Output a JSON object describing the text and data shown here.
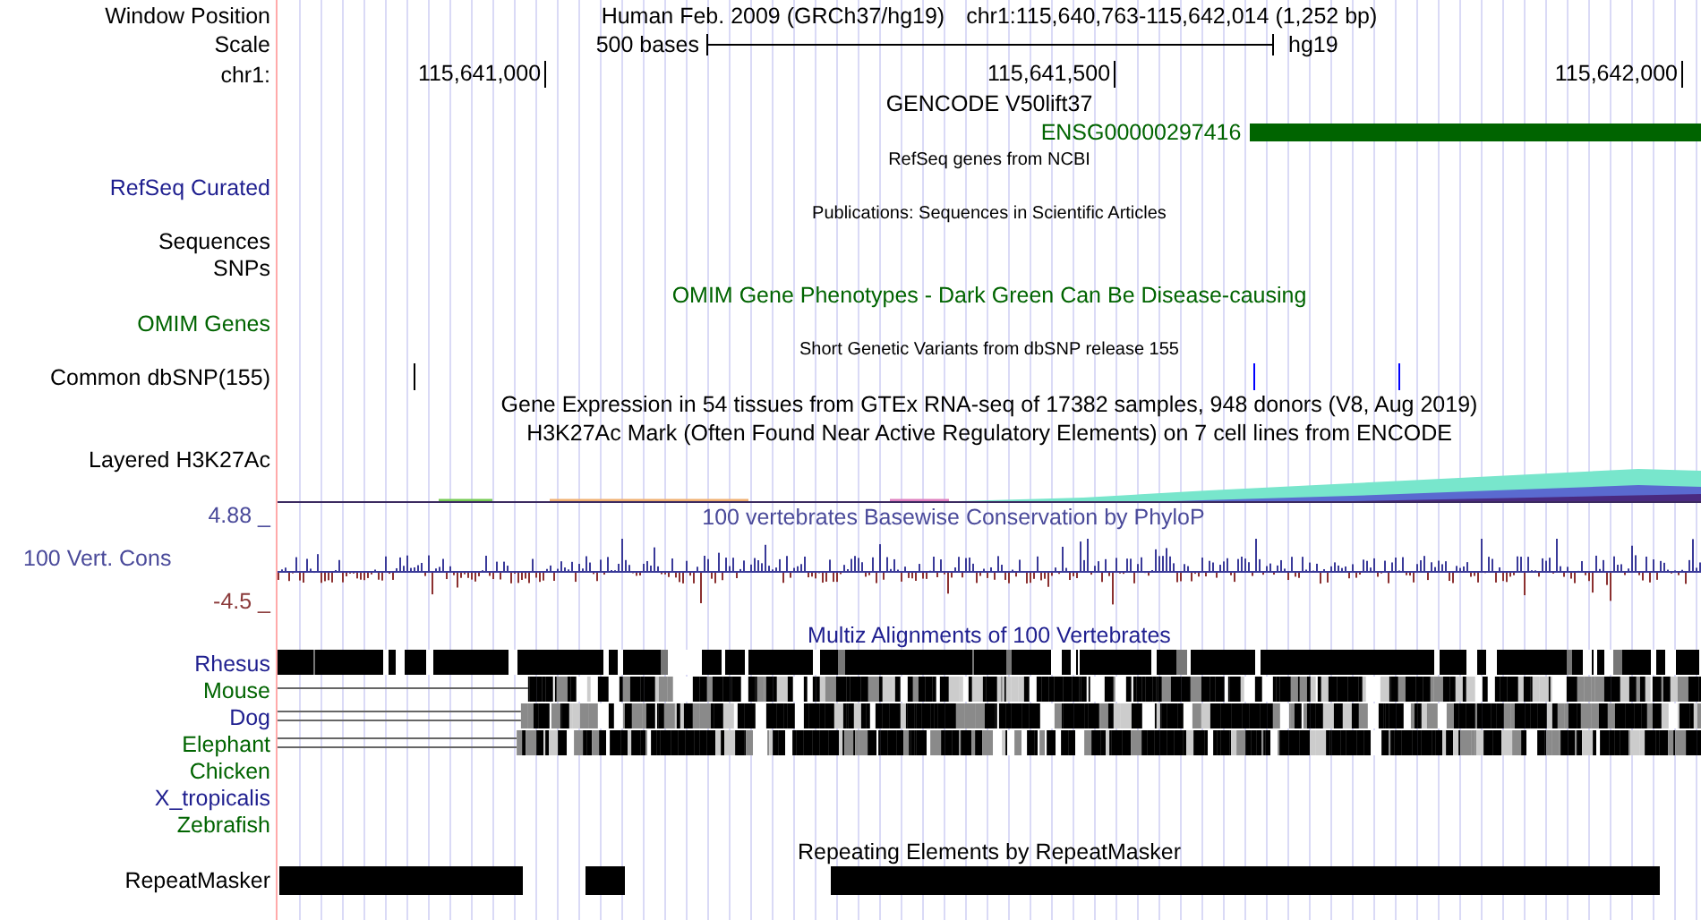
{
  "header": {
    "label": "Window Position",
    "assembly": "Human Feb. 2009 (GRCh37/hg19)",
    "position": "chr1:115,640,763-115,642,014 (1,252 bp)"
  },
  "scale": {
    "label": "Scale",
    "length": "500 bases",
    "assembly": "hg19"
  },
  "ruler": {
    "label": "chr1:",
    "ticks": [
      "115,641,000",
      "115,641,500",
      "115,642,000"
    ]
  },
  "tracks": [
    {
      "kind": "title",
      "text": "GENCODE V50lift37",
      "color": "#000000"
    },
    {
      "kind": "gene",
      "name": "ENSG00000297416",
      "color": "#006400"
    },
    {
      "kind": "note",
      "text": "RefSeq genes from NCBI"
    },
    {
      "kind": "label",
      "label": "RefSeq Curated",
      "color": "#1f1f8f"
    },
    {
      "kind": "note",
      "text": "Publications: Sequences in Scientific Articles"
    },
    {
      "kind": "label",
      "label": "Sequences",
      "color": "#000000"
    },
    {
      "kind": "label",
      "label": "SNPs",
      "color": "#000000"
    },
    {
      "kind": "title",
      "text": "OMIM Gene Phenotypes - Dark Green Can Be Disease-causing",
      "color": "#006400"
    },
    {
      "kind": "label",
      "label": "OMIM Genes",
      "color": "#006400"
    },
    {
      "kind": "note",
      "text": "Short Genetic Variants from dbSNP release 155"
    },
    {
      "kind": "variants",
      "label": "Common dbSNP(155)",
      "color": "#000000",
      "variants": [
        {
          "color": "#000000"
        },
        {
          "color": "#0000ff"
        },
        {
          "color": "#0000ff"
        }
      ]
    },
    {
      "kind": "title",
      "text": "Gene Expression in 54 tissues from GTEx RNA-seq of 17382 samples, 948 donors (V8, Aug 2019)",
      "color": "#000000"
    },
    {
      "kind": "title",
      "text": "H3K27Ac Mark (Often Found Near Active Regulatory Elements) on 7 cell lines from ENCODE",
      "color": "#000000"
    },
    {
      "kind": "layered",
      "label": "Layered H3K27Ac",
      "color": "#000000"
    },
    {
      "kind": "wiggle",
      "label": "100 Vert. Cons",
      "color": "#4a4a9a",
      "title": "100 vertebrates Basewise Conservation by PhyloP",
      "max": "4.88 _",
      "min": "-4.5 _"
    },
    {
      "kind": "title",
      "text": "Multiz Alignments of 100 Vertebrates",
      "color": "#1f1f8f"
    },
    {
      "kind": "alignment",
      "label": "Rhesus",
      "color": "#1f1f8f"
    },
    {
      "kind": "alignment",
      "label": "Mouse",
      "color": "#006400"
    },
    {
      "kind": "alignment",
      "label": "Dog",
      "color": "#1f1f8f"
    },
    {
      "kind": "alignment",
      "label": "Elephant",
      "color": "#006400"
    },
    {
      "kind": "alignment",
      "label": "Chicken",
      "color": "#006400"
    },
    {
      "kind": "alignment",
      "label": "X_tropicalis",
      "color": "#1f1f8f"
    },
    {
      "kind": "alignment",
      "label": "Zebrafish",
      "color": "#006400"
    },
    {
      "kind": "title",
      "text": "Repeating Elements by RepeatMasker",
      "color": "#000000"
    },
    {
      "kind": "repeats",
      "label": "RepeatMasker",
      "color": "#000000"
    }
  ]
}
